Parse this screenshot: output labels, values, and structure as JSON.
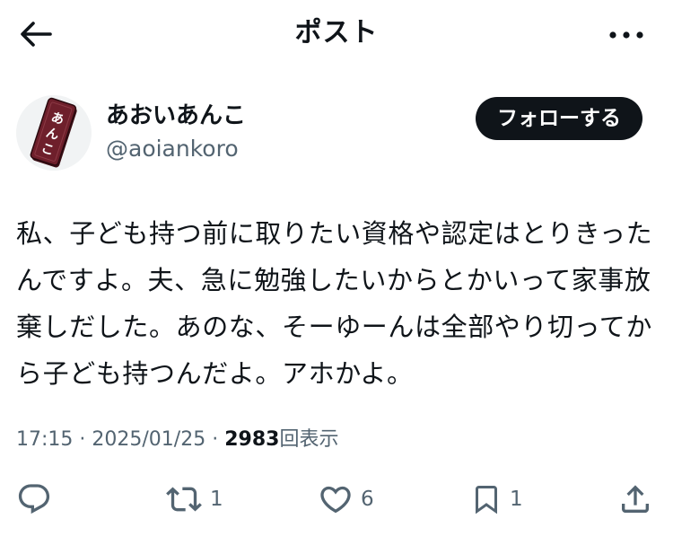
{
  "header": {
    "title": "ポスト"
  },
  "author": {
    "display_name": "あおいあんこ",
    "handle": "@aoiankoro",
    "follow_label": "フォローする",
    "avatar_text": "あんこ"
  },
  "post": {
    "text": "私、子ども持つ前に取りたい資格や認定はとりきったんですよ。夫、急に勉強したいからとかいって家事放棄しだした。あのな、そーゆーんは全部やり切ってから子ども持つんだよ。アホかよ。",
    "time": "17:15",
    "date": "2025/01/25",
    "views_count": "2983",
    "views_label": "回表示",
    "separator": "·"
  },
  "actions": {
    "reply_count": "",
    "repost_count": "1",
    "like_count": "6",
    "bookmark_count": "1"
  },
  "icons": {
    "back": "arrow-left-icon",
    "more": "more-horizontal-icon",
    "reply": "reply-icon",
    "repost": "repost-icon",
    "like": "heart-icon",
    "bookmark": "bookmark-icon",
    "share": "share-icon"
  },
  "colors": {
    "text": "#0f1419",
    "secondary": "#536471",
    "button_bg": "#0f1419",
    "avatar_board": "#6e1f2b"
  }
}
